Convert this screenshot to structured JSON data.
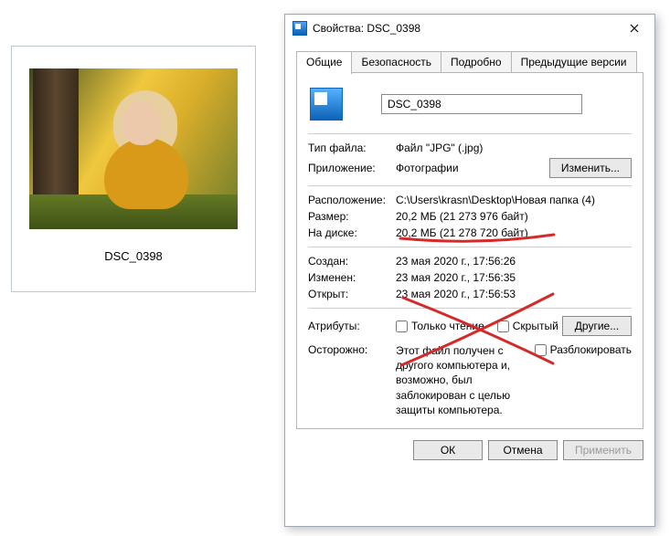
{
  "thumbnail": {
    "caption": "DSC_0398"
  },
  "dialog": {
    "title": "Свойства: DSC_0398",
    "tabs": {
      "general": "Общие",
      "security": "Безопасность",
      "details": "Подробно",
      "previous": "Предыдущие версии"
    },
    "filename": "DSC_0398",
    "fields": {
      "type_label": "Тип файла:",
      "type_value": "Файл \"JPG\" (.jpg)",
      "app_label": "Приложение:",
      "app_value": "Фотографии",
      "change_button": "Изменить...",
      "location_label": "Расположение:",
      "location_value": "C:\\Users\\krasn\\Desktop\\Новая папка (4)",
      "size_label": "Размер:",
      "size_value": "20,2 МБ (21 273 976 байт)",
      "disk_label": "На диске:",
      "disk_value": "20,2 МБ (21 278 720 байт)",
      "created_label": "Создан:",
      "created_value": "23 мая 2020 г., 17:56:26",
      "modified_label": "Изменен:",
      "modified_value": "23 мая 2020 г., 17:56:35",
      "accessed_label": "Открыт:",
      "accessed_value": "23 мая 2020 г., 17:56:53",
      "attributes_label": "Атрибуты:",
      "readonly_label": "Только чтение",
      "hidden_label": "Скрытый",
      "other_button": "Другие...",
      "warning_label": "Осторожно:",
      "warning_text": "Этот файл получен с другого компьютера и, возможно, был заблокирован с целью защиты компьютера.",
      "unblock_label": "Разблокировать"
    },
    "buttons": {
      "ok": "ОК",
      "cancel": "Отмена",
      "apply": "Применить"
    }
  }
}
